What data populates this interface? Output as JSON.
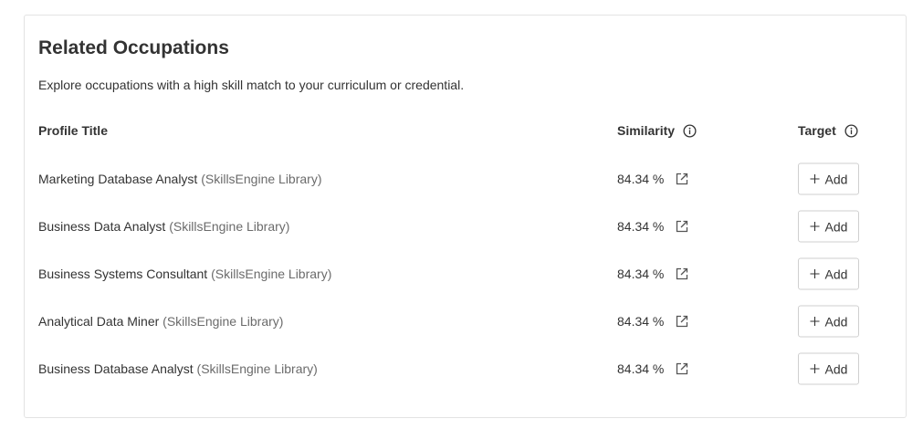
{
  "section": {
    "title": "Related Occupations",
    "description": "Explore occupations with a high skill match to your curriculum or credential."
  },
  "table": {
    "headers": {
      "profile_title": "Profile Title",
      "similarity": "Similarity",
      "target": "Target"
    },
    "rows": [
      {
        "title": "Marketing Database Analyst",
        "library": "(SkillsEngine Library)",
        "similarity": "84.34 %",
        "action": "Add"
      },
      {
        "title": "Business Data Analyst",
        "library": "(SkillsEngine Library)",
        "similarity": "84.34 %",
        "action": "Add"
      },
      {
        "title": "Business Systems Consultant",
        "library": "(SkillsEngine Library)",
        "similarity": "84.34 %",
        "action": "Add"
      },
      {
        "title": "Analytical Data Miner",
        "library": "(SkillsEngine Library)",
        "similarity": "84.34 %",
        "action": "Add"
      },
      {
        "title": "Business Database Analyst",
        "library": "(SkillsEngine Library)",
        "similarity": "84.34 %",
        "action": "Add"
      }
    ]
  },
  "icons": {
    "header_info": "info-circle-icon",
    "row_link": "external-link-icon",
    "add": "plus-icon"
  },
  "colors": {
    "text": "#333333",
    "library_text": "#6b6b6b",
    "border": "#e3e3e3"
  }
}
